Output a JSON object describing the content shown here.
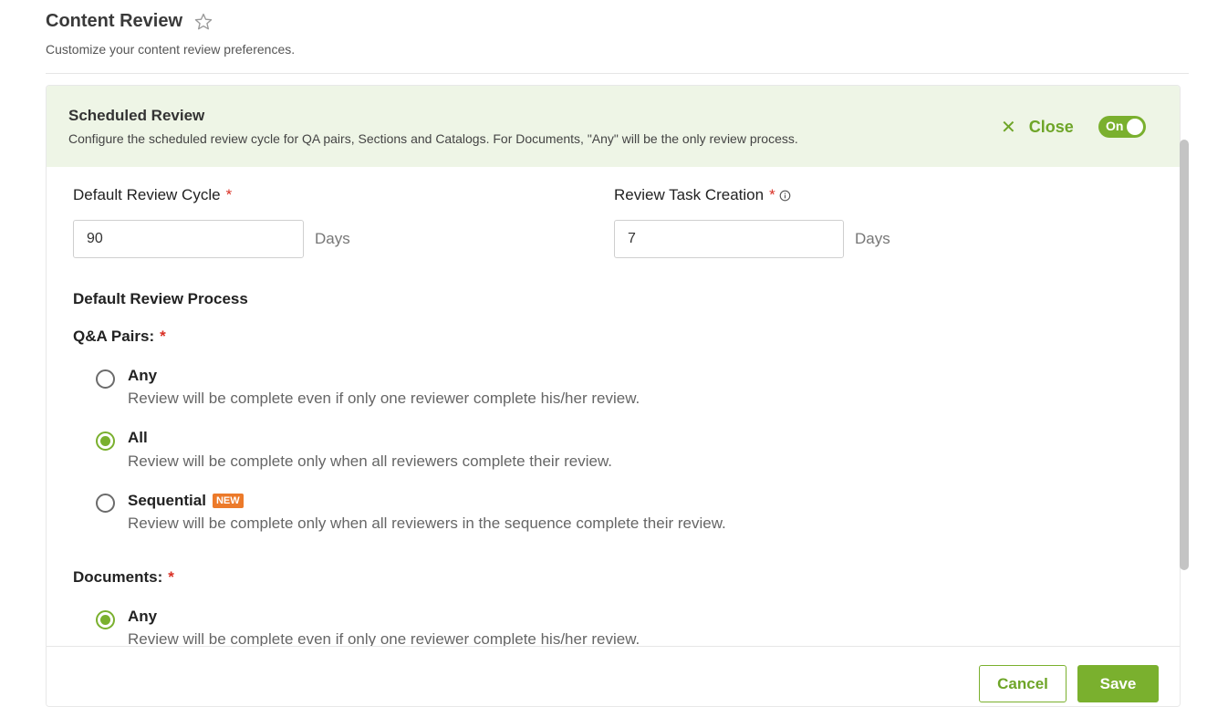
{
  "header": {
    "title": "Content Review",
    "star_icon": "star-outline-icon",
    "subtitle": "Customize your content review preferences."
  },
  "panel": {
    "title": "Scheduled Review",
    "description": "Configure the scheduled review cycle for QA pairs, Sections and Catalogs. For Documents, \"Any\" will be the only review process.",
    "close_label": "Close",
    "toggle_label": "On",
    "accent_color": "#7ab02e",
    "header_bg": "#eef5e6"
  },
  "fields": {
    "review_cycle": {
      "label": "Default Review Cycle",
      "required": "*",
      "value": "90",
      "unit": "Days"
    },
    "task_creation": {
      "label": "Review Task Creation",
      "required": "*",
      "value": "7",
      "unit": "Days",
      "icon": "info-icon"
    }
  },
  "process": {
    "title": "Default Review Process",
    "qa": {
      "label": "Q&A Pairs:",
      "required": "*",
      "options": [
        {
          "title": "Any",
          "desc": "Review will be complete even if only one reviewer complete his/her review.",
          "checked": false
        },
        {
          "title": "All",
          "desc": "Review will be complete only when all reviewers complete their review.",
          "checked": true
        },
        {
          "title": "Sequential",
          "badge": "NEW",
          "desc": "Review will be complete only when all reviewers in the sequence complete their review.",
          "checked": false
        }
      ]
    },
    "documents": {
      "label": "Documents:",
      "required": "*",
      "options": [
        {
          "title": "Any",
          "desc": "Review will be complete even if only one reviewer complete his/her review.",
          "checked": true
        }
      ]
    }
  },
  "footer": {
    "cancel_label": "Cancel",
    "save_label": "Save"
  }
}
